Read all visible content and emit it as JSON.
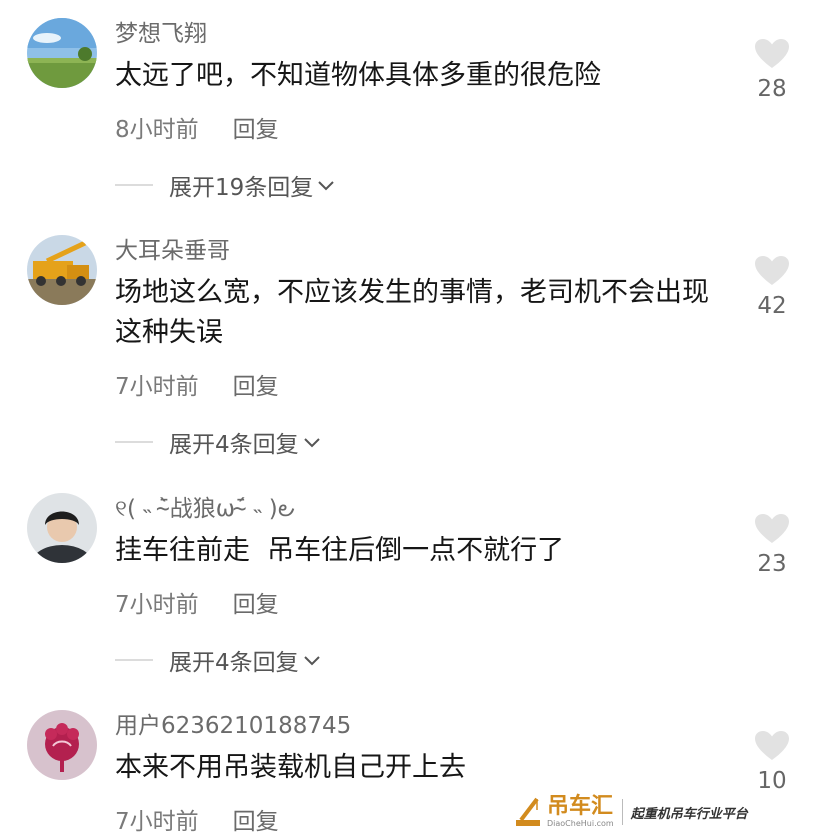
{
  "comments": [
    {
      "author": "梦想飞翔",
      "text": "太远了吧，不知道物体具体多重的很危险",
      "time": "8小时前",
      "reply_label": "回复",
      "expand_label": "展开19条回复",
      "likes": "28"
    },
    {
      "author": "大耳朵垂哥",
      "text": "场地这么宽，不应该发生的事情，老司机不会出现这种失误",
      "time": "7小时前",
      "reply_label": "回复",
      "expand_label": "展开4条回复",
      "likes": "42"
    },
    {
      "author": "୧( ˵ ¯̴̀战狼ω¯̴́ ˵ )౿",
      "text": "挂车往前走  吊车往后倒一点不就行了",
      "time": "7小时前",
      "reply_label": "回复",
      "expand_label": "展开4条回复",
      "likes": "23"
    },
    {
      "author": "用户6236210188745",
      "text": "本来不用吊装载机自己开上去",
      "time": "7小时前",
      "reply_label": "回复",
      "likes": "10"
    }
  ],
  "watermark": {
    "name": "吊车汇",
    "url": "DiaoCheHui.com",
    "slogan": "起重机吊车行业平台"
  },
  "colors": {
    "author": "#6b6b6b",
    "meta": "#7a7a7a",
    "heart": "#e2e2e2",
    "watermark_brand": "#d28b1e"
  },
  "icons": {
    "like": "heart-icon",
    "expand": "chevron-down-icon"
  }
}
